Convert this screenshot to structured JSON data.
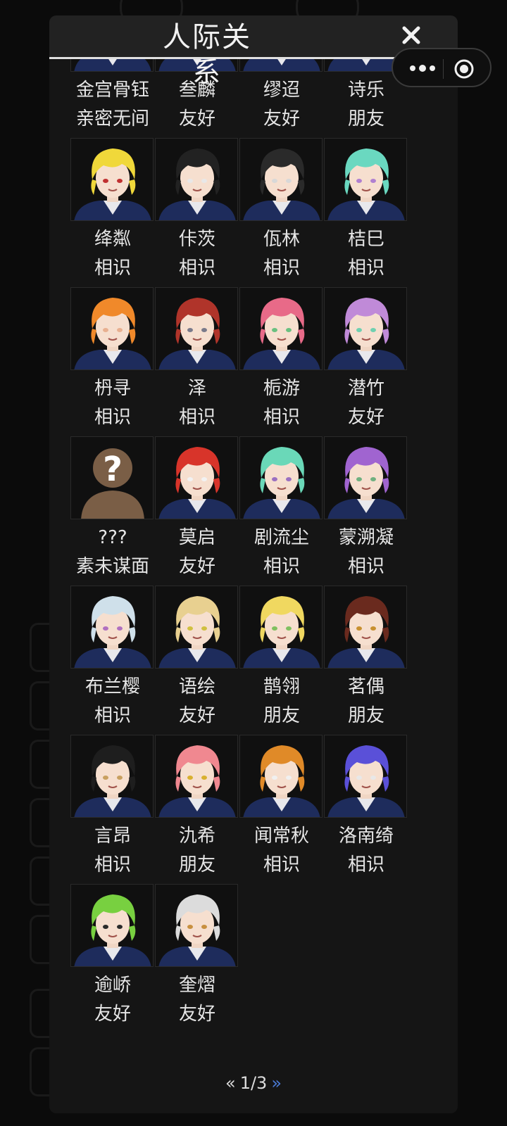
{
  "dialog": {
    "title": "人际关系",
    "close_label": "✕"
  },
  "miniprogram_capsule": {
    "more_label": "•••"
  },
  "pagination": {
    "prev_label": "«",
    "current": "1/3",
    "next_label": "»"
  },
  "characters": [
    {
      "name": "金宫骨钰",
      "relation": "亲密无间",
      "hair": "#c9a640",
      "accent": "#e0c24a"
    },
    {
      "name": "叁麟",
      "relation": "友好",
      "hair": "#3b8a56",
      "accent": "#b03040"
    },
    {
      "name": "缪迢",
      "relation": "友好",
      "hair": "#caa23a",
      "accent": "#e0e0e0"
    },
    {
      "name": "诗乐",
      "relation": "朋友",
      "hair": "#e06aa0",
      "accent": "#50b0c0"
    },
    {
      "name": "绛粼",
      "relation": "相识",
      "hair": "#f0d83a",
      "accent": "#c03030"
    },
    {
      "name": "佧茨",
      "relation": "相识",
      "hair": "#222222",
      "accent": "#e8e8e8"
    },
    {
      "name": "佤林",
      "relation": "相识",
      "hair": "#2a2a2a",
      "accent": "#d8d8d8"
    },
    {
      "name": "桔巳",
      "relation": "相识",
      "hair": "#6ad8c0",
      "accent": "#b080d0"
    },
    {
      "name": "枬寻",
      "relation": "相识",
      "hair": "#f0892a",
      "accent": "#e8b090"
    },
    {
      "name": "泽",
      "relation": "相识",
      "hair": "#b0342a",
      "accent": "#7a7a8a"
    },
    {
      "name": "栀游",
      "relation": "相识",
      "hair": "#e86a88",
      "accent": "#6ac080"
    },
    {
      "name": "潜竹",
      "relation": "友好",
      "hair": "#c08ad8",
      "accent": "#70d0b0"
    },
    {
      "name": "???",
      "relation": "素未谋面",
      "hair": "#7a5e46",
      "accent": "#ffffff",
      "unknown": true
    },
    {
      "name": "莫启",
      "relation": "友好",
      "hair": "#d8342a",
      "accent": "#f2f2f2"
    },
    {
      "name": "剧流尘",
      "relation": "相识",
      "hair": "#6ad8b8",
      "accent": "#9a70c0"
    },
    {
      "name": "蒙溯凝",
      "relation": "相识",
      "hair": "#a064d0",
      "accent": "#70b080"
    },
    {
      "name": "布兰樱",
      "relation": "相识",
      "hair": "#cfe0ea",
      "accent": "#b070c0"
    },
    {
      "name": "语绘",
      "relation": "友好",
      "hair": "#e8d090",
      "accent": "#d0c040"
    },
    {
      "name": "鹊翎",
      "relation": "朋友",
      "hair": "#f0d860",
      "accent": "#80c060"
    },
    {
      "name": "茗偶",
      "relation": "朋友",
      "hair": "#6a2a1e",
      "accent": "#c89030"
    },
    {
      "name": "言昂",
      "relation": "相识",
      "hair": "#1e1e1e",
      "accent": "#c8a060"
    },
    {
      "name": "氿希",
      "relation": "朋友",
      "hair": "#f08890",
      "accent": "#d8b030"
    },
    {
      "name": "闻常秋",
      "relation": "相识",
      "hair": "#e08a28",
      "accent": "#f0f0f0"
    },
    {
      "name": "洛南绮",
      "relation": "相识",
      "hair": "#5a50d8",
      "accent": "#e8e8e8"
    },
    {
      "name": "逾峤",
      "relation": "友好",
      "hair": "#78d040",
      "accent": "#2a2a2a"
    },
    {
      "name": "奎熠",
      "relation": "友好",
      "hair": "#dcdcdc",
      "accent": "#c89040"
    }
  ]
}
